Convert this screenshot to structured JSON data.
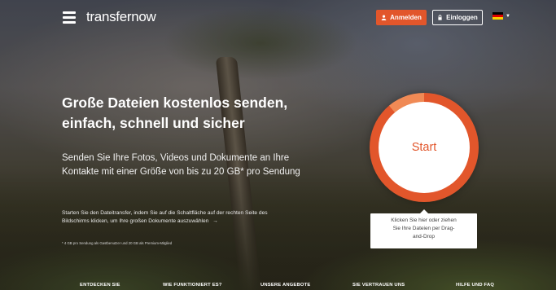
{
  "header": {
    "logo_text": "transfernow",
    "signup_label": "Anmelden",
    "login_label": "Einloggen",
    "language_flag": "de-flag-icon"
  },
  "hero": {
    "headline_line1": "Große Dateien kostenlos senden,",
    "headline_line2": "einfach, schnell und sicher",
    "subline_line1": "Senden Sie Ihre Fotos, Videos und Dokumente an Ihre",
    "subline_line2": "Kontakte mit einer Größe von bis zu 20 GB* pro Sendung",
    "desc_line1": "Starten Sie den Dateitransfer, indem Sie auf die Schaltfläche auf der rechten Seite des",
    "desc_line2": "Bildschirms klicken, um Ihre großen Dokumente auszuwählen",
    "desc_arrow": "→",
    "note": "* 4 GB pro Sendung als Gastbenutzer und 20 GB als Premium-Mitglied"
  },
  "start": {
    "label": "Start",
    "tooltip_line1": "Klicken Sie hier oder ziehen",
    "tooltip_line2": "Sie Ihre Dateien per Drag-",
    "tooltip_line3": "and-Drop"
  },
  "footer_nav": [
    "ENTDECKEN SIE",
    "WIE FUNKTIONIERT ES?",
    "UNSERE ANGEBOTE",
    "SIE VERTRAUEN UNS",
    "HILFE UND FAQ"
  ],
  "colors": {
    "accent": "#e2562b",
    "flag_black": "#000000",
    "flag_red": "#dd0000",
    "flag_gold": "#ffce00"
  }
}
